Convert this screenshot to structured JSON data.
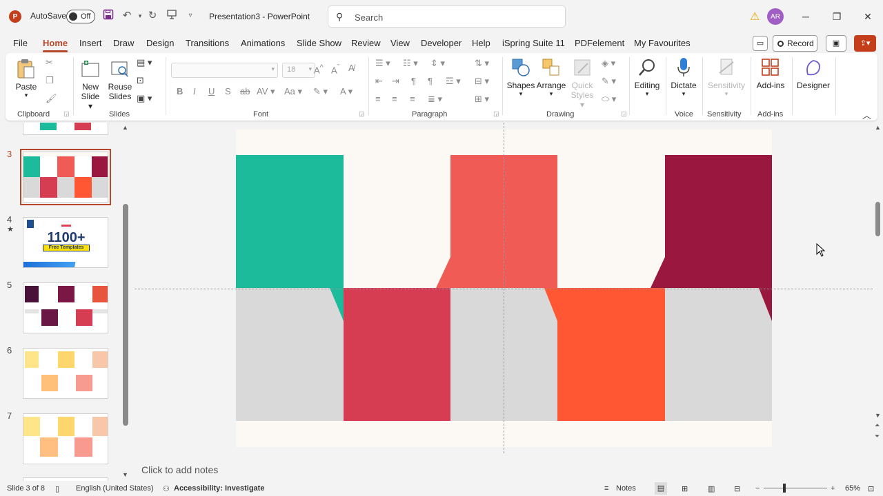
{
  "titlebar": {
    "autosave_label": "AutoSave",
    "autosave_state": "Off",
    "doc_title": "Presentation3  -  PowerPoint",
    "search_placeholder": "Search",
    "avatar_initials": "AR"
  },
  "menu": {
    "tabs": [
      "File",
      "Home",
      "Insert",
      "Draw",
      "Design",
      "Transitions",
      "Animations",
      "Slide Show",
      "Review",
      "View",
      "Developer",
      "Help",
      "iSpring Suite 11",
      "PDFelement",
      "My Favourites"
    ],
    "active": "Home",
    "record_label": "Record"
  },
  "ribbon": {
    "groups": {
      "clipboard": "Clipboard",
      "slides": "Slides",
      "font": "Font",
      "paragraph": "Paragraph",
      "drawing": "Drawing",
      "voice": "Voice",
      "sensitivity": "Sensitivity",
      "addins": "Add-ins"
    },
    "buttons": {
      "paste": "Paste",
      "new_slide_1": "New",
      "new_slide_2": "Slide",
      "reuse_1": "Reuse",
      "reuse_2": "Slides",
      "shapes": "Shapes",
      "arrange": "Arrange",
      "quick_1": "Quick",
      "quick_2": "Styles",
      "editing": "Editing",
      "dictate": "Dictate",
      "sensitivity": "Sensitivity",
      "addins": "Add-ins",
      "designer": "Designer"
    },
    "font_size": "18"
  },
  "thumbnails": {
    "items": [
      {
        "num": "3",
        "selected": true
      },
      {
        "num": "4",
        "starred": true,
        "big_text": "1100+",
        "sub_text": "Free Templates"
      },
      {
        "num": "5"
      },
      {
        "num": "6"
      },
      {
        "num": "7"
      }
    ]
  },
  "slide": {
    "colors": {
      "teal": "#1cbb9b",
      "coral": "#f05b55",
      "maroon": "#9a1740",
      "crimson": "#d63c52",
      "orange": "#ff5733",
      "gray": "#d9d9d9",
      "background": "#fcf8f4"
    }
  },
  "notes": {
    "placeholder": "Click to add notes"
  },
  "status": {
    "slide_info": "Slide 3 of 8",
    "language": "English (United States)",
    "accessibility": "Accessibility: Investigate",
    "notes_label": "Notes",
    "zoom": "65%"
  }
}
